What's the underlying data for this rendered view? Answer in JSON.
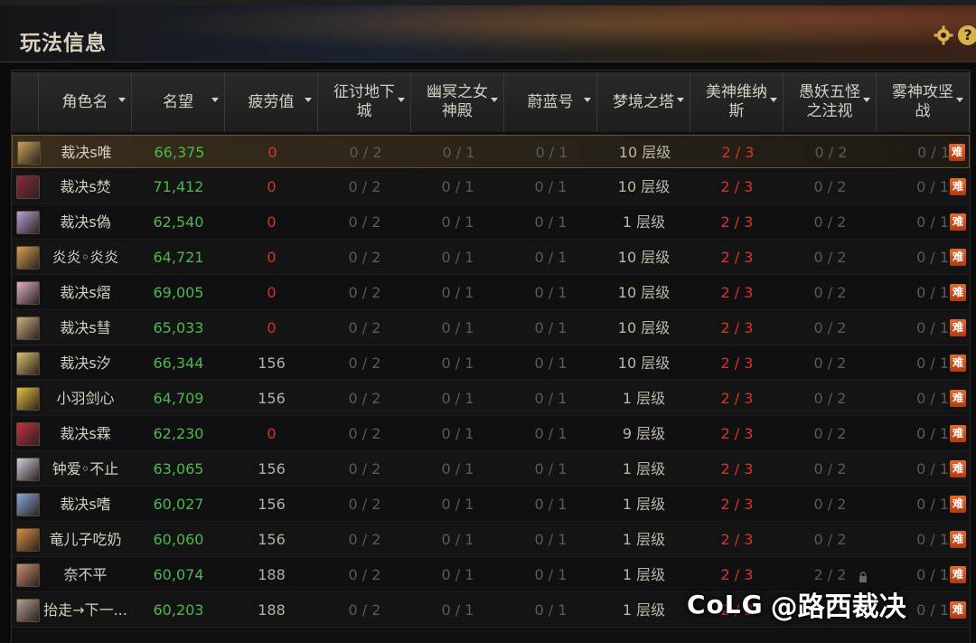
{
  "window": {
    "title": "玩法信息"
  },
  "icons": {
    "settings": "gear-icon",
    "help": "question-icon"
  },
  "help_label": "?",
  "columns": [
    {
      "label": "角色名",
      "sortable": true
    },
    {
      "label": "名望",
      "sortable": true
    },
    {
      "label": "疲劳值",
      "sortable": true
    },
    {
      "label": "征讨地下城",
      "sortable": true
    },
    {
      "label": "幽冥之女神殿",
      "sortable": true
    },
    {
      "label": "蔚蓝号",
      "sortable": true
    },
    {
      "label": "梦境之塔",
      "sortable": true
    },
    {
      "label": "美神维纳斯",
      "sortable": true
    },
    {
      "label": "愚妖五怪之注视",
      "sortable": true
    },
    {
      "label": "雾神攻坚战",
      "sortable": true
    }
  ],
  "hard_badge": "难",
  "rows": [
    {
      "name": "裁决s唯",
      "fame": "66,375",
      "fatigue": "0",
      "dungeon": "0 / 2",
      "goddess_temple": "0 / 1",
      "azure": "0 / 1",
      "tower": "10 层级",
      "venus": "2 / 3",
      "five_demons": "0 / 2",
      "mist": "0 / 1",
      "selected": true
    },
    {
      "name": "裁决s焚",
      "fame": "71,412",
      "fatigue": "0",
      "dungeon": "0 / 2",
      "goddess_temple": "0 / 1",
      "azure": "0 / 1",
      "tower": "10 层级",
      "venus": "2 / 3",
      "five_demons": "0 / 2",
      "mist": "0 / 1"
    },
    {
      "name": "裁决s偽",
      "fame": "62,540",
      "fatigue": "0",
      "dungeon": "0 / 2",
      "goddess_temple": "0 / 1",
      "azure": "0 / 1",
      "tower": "1 层级",
      "venus": "2 / 3",
      "five_demons": "0 / 2",
      "mist": "0 / 1"
    },
    {
      "name": "炎炎◦炎炎",
      "fame": "64,721",
      "fatigue": "0",
      "dungeon": "0 / 2",
      "goddess_temple": "0 / 1",
      "azure": "0 / 1",
      "tower": "10 层级",
      "venus": "2 / 3",
      "five_demons": "0 / 2",
      "mist": "0 / 1"
    },
    {
      "name": "裁决s熠",
      "fame": "69,005",
      "fatigue": "0",
      "dungeon": "0 / 2",
      "goddess_temple": "0 / 1",
      "azure": "0 / 1",
      "tower": "10 层级",
      "venus": "2 / 3",
      "five_demons": "0 / 2",
      "mist": "0 / 1"
    },
    {
      "name": "裁决s彗",
      "fame": "65,033",
      "fatigue": "0",
      "dungeon": "0 / 2",
      "goddess_temple": "0 / 1",
      "azure": "0 / 1",
      "tower": "10 层级",
      "venus": "2 / 3",
      "five_demons": "0 / 2",
      "mist": "0 / 1"
    },
    {
      "name": "裁决s汐",
      "fame": "66,344",
      "fatigue": "156",
      "dungeon": "0 / 2",
      "goddess_temple": "0 / 1",
      "azure": "0 / 1",
      "tower": "10 层级",
      "venus": "2 / 3",
      "five_demons": "0 / 2",
      "mist": "0 / 1"
    },
    {
      "name": "小羽剑心",
      "fame": "64,709",
      "fatigue": "156",
      "dungeon": "0 / 2",
      "goddess_temple": "0 / 1",
      "azure": "0 / 1",
      "tower": "1 层级",
      "venus": "2 / 3",
      "five_demons": "0 / 2",
      "mist": "0 / 1"
    },
    {
      "name": "裁决s霖",
      "fame": "62,230",
      "fatigue": "0",
      "dungeon": "0 / 2",
      "goddess_temple": "0 / 1",
      "azure": "0 / 1",
      "tower": "9 层级",
      "venus": "2 / 3",
      "five_demons": "0 / 2",
      "mist": "0 / 1"
    },
    {
      "name": "钟爱◦不止",
      "fame": "63,065",
      "fatigue": "156",
      "dungeon": "0 / 2",
      "goddess_temple": "0 / 1",
      "azure": "0 / 1",
      "tower": "1 层级",
      "venus": "2 / 3",
      "five_demons": "0 / 2",
      "mist": "0 / 1"
    },
    {
      "name": "裁决s嗜",
      "fame": "60,027",
      "fatigue": "156",
      "dungeon": "0 / 2",
      "goddess_temple": "0 / 1",
      "azure": "0 / 1",
      "tower": "1 层级",
      "venus": "2 / 3",
      "five_demons": "0 / 2",
      "mist": "0 / 1"
    },
    {
      "name": "竜儿子吃奶",
      "fame": "60,060",
      "fatigue": "156",
      "dungeon": "0 / 2",
      "goddess_temple": "0 / 1",
      "azure": "0 / 1",
      "tower": "1 层级",
      "venus": "2 / 3",
      "five_demons": "0 / 2",
      "mist": "0 / 1"
    },
    {
      "name": "奈不平",
      "fame": "60,074",
      "fatigue": "188",
      "dungeon": "0 / 2",
      "goddess_temple": "0 / 1",
      "azure": "0 / 1",
      "tower": "1 层级",
      "venus": "2 / 3",
      "five_demons": "2 / 2",
      "mist": "0 / 1",
      "locked": true
    },
    {
      "name": "抬走→下一...",
      "fame": "60,203",
      "fatigue": "188",
      "dungeon": "0 / 2",
      "goddess_temple": "0 / 1",
      "azure": "0 / 1",
      "tower": "1 层级",
      "venus": "2 / 3",
      "five_demons": "0 / 2",
      "mist": "0 / 1"
    }
  ],
  "avatar_colors": [
    "#c9a35a",
    "#8a2a3a",
    "#b8a0d8",
    "#d8a050",
    "#e0b0c8",
    "#c8b080",
    "#d8c070",
    "#e8c040",
    "#c83040",
    "#d0d0e0",
    "#8aa8e0",
    "#d89040",
    "#c89070",
    "#b0a090"
  ],
  "colors": {
    "fame": "#4fb74b",
    "warn": "#d8352a",
    "badge": "#d9582a"
  },
  "watermark": {
    "brand": "CoLG",
    "handle": "@路西裁决"
  }
}
